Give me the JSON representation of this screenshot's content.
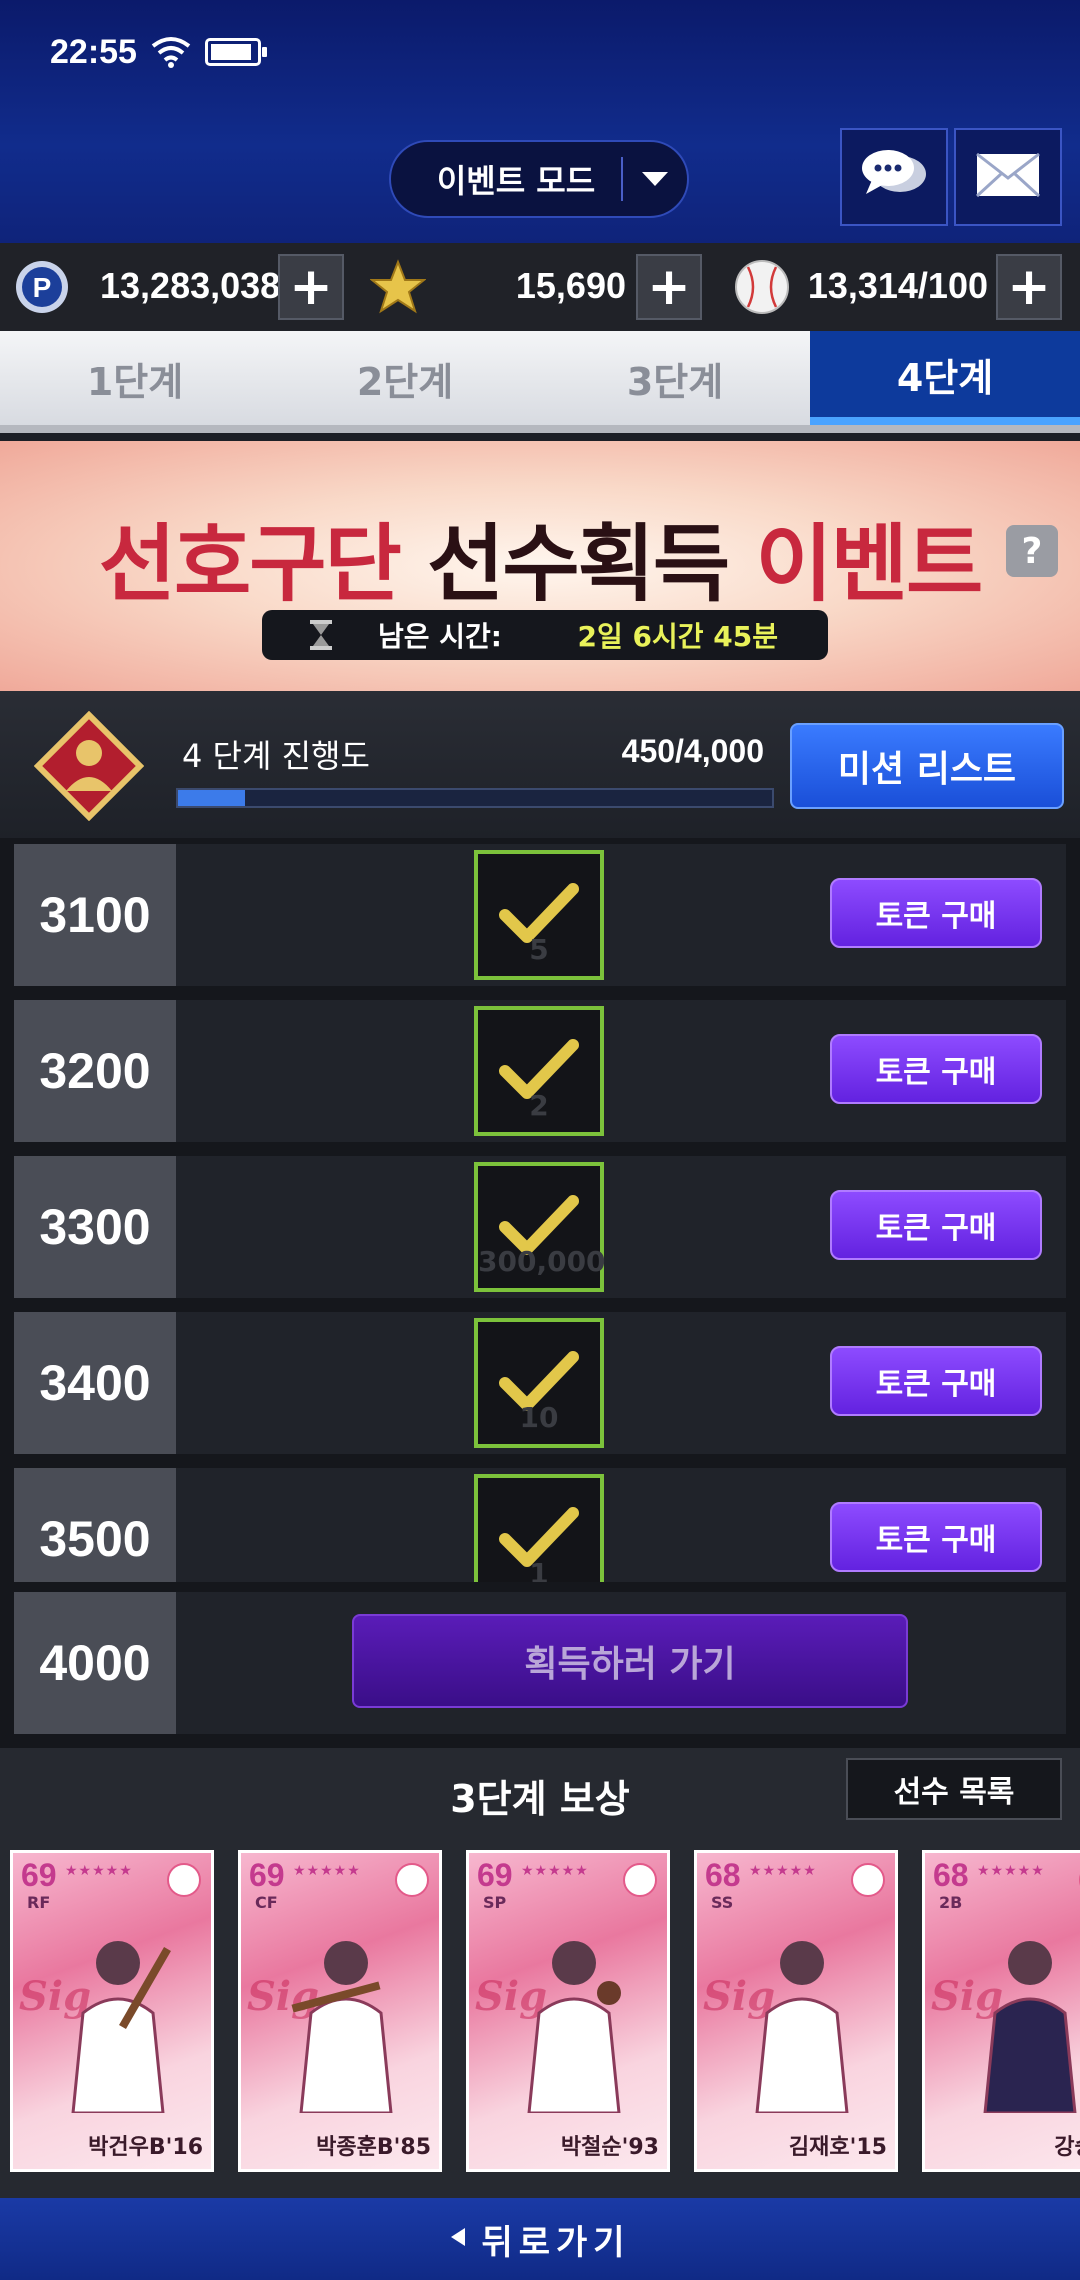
{
  "status": {
    "time": "22:55"
  },
  "header": {
    "mode_label": "이벤트 모드"
  },
  "currency": [
    {
      "icon": "p-coin-icon",
      "value": "13,283,038"
    },
    {
      "icon": "star-icon",
      "value": "15,690"
    },
    {
      "icon": "baseball-icon",
      "value": "13,314/100"
    }
  ],
  "tabs": [
    {
      "label": "1단계",
      "active": false
    },
    {
      "label": "2단계",
      "active": false
    },
    {
      "label": "3단계",
      "active": false
    },
    {
      "label": "4단계",
      "active": true
    }
  ],
  "banner": {
    "title_part1": "선호구단",
    "title_part2": "선수획득",
    "title_part3": "이벤트",
    "timer_label": "남은 시간:",
    "timer_value": "2일 6시간 45분"
  },
  "progress": {
    "label": "4 단계 진행도",
    "value": "450/4,000",
    "fraction": 0.1125,
    "button": "미션 리스트"
  },
  "rows": [
    {
      "milestone": "3100",
      "faint": "5",
      "buy": "토큰 구매"
    },
    {
      "milestone": "3200",
      "faint": "2",
      "buy": "토큰 구매"
    },
    {
      "milestone": "3300",
      "faint": "300,000",
      "buy": "토큰 구매"
    },
    {
      "milestone": "3400",
      "faint": "10",
      "buy": "토큰 구매"
    },
    {
      "milestone": "3500",
      "faint": "1",
      "buy": "토큰 구매"
    }
  ],
  "final_row": {
    "milestone": "4000",
    "button": "획득하러 가기"
  },
  "rewards": {
    "title": "3단계 보상",
    "list_button": "선수 목록",
    "cards": [
      {
        "ovr": "69",
        "pos": "RF",
        "name": "박건우B'16"
      },
      {
        "ovr": "69",
        "pos": "CF",
        "name": "박종훈B'85"
      },
      {
        "ovr": "69",
        "pos": "SP",
        "name": "박철순'93"
      },
      {
        "ovr": "68",
        "pos": "SS",
        "name": "김재호'15"
      },
      {
        "ovr": "68",
        "pos": "2B",
        "name": "강승호"
      }
    ]
  },
  "footer": {
    "back_label": "뒤로가기"
  },
  "colors": {
    "accent_blue": "#0d3a9c",
    "check_green": "#7cc23b",
    "buy_purple": "#6322e0"
  }
}
